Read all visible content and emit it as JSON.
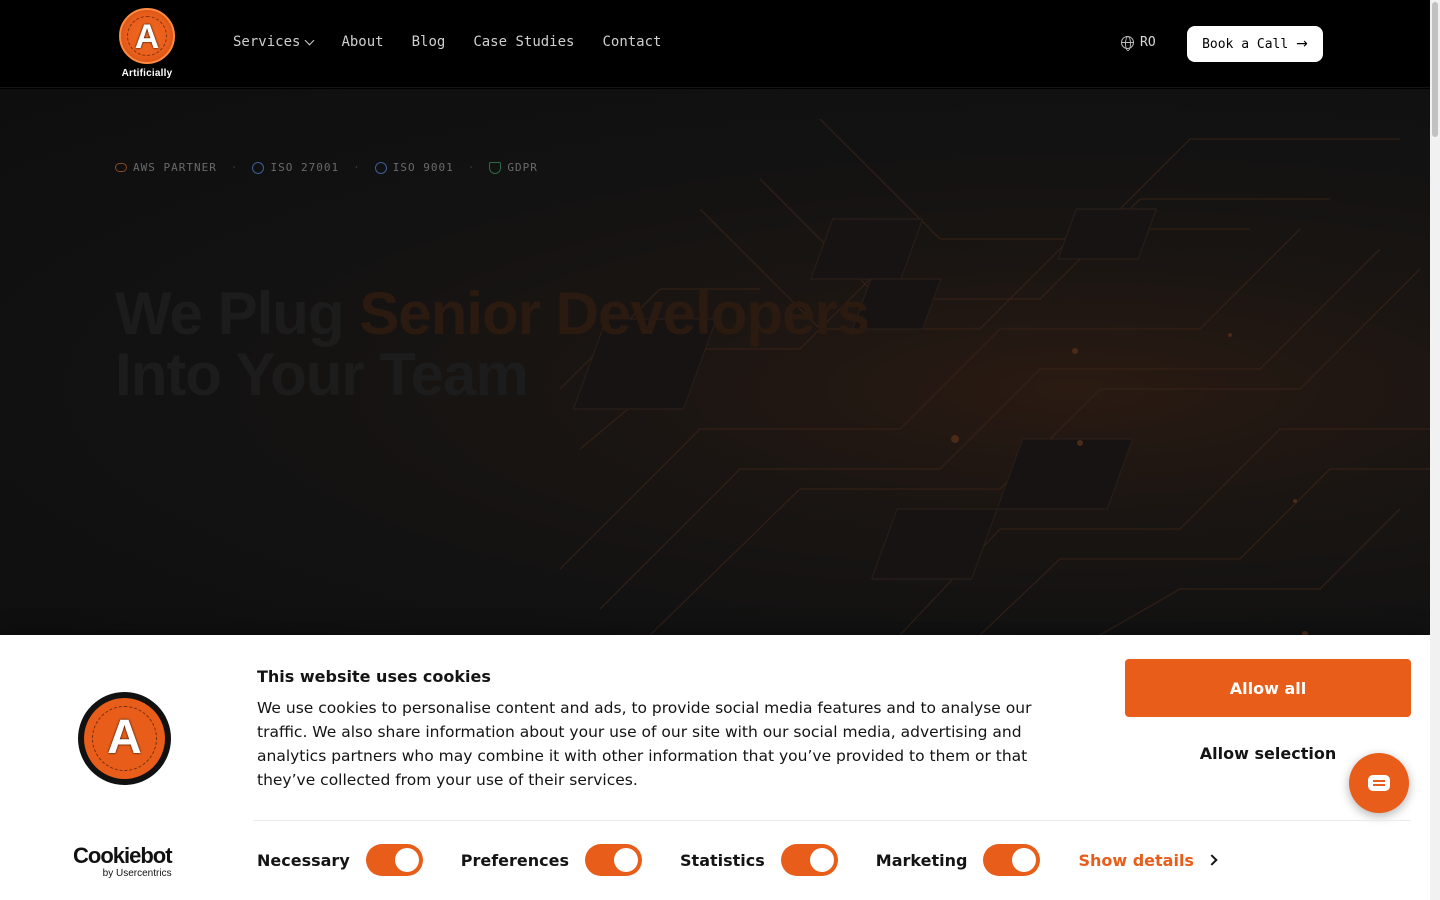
{
  "header": {
    "logo_text": "Artificially",
    "logo_letter": "A",
    "nav": [
      {
        "label": "Services",
        "has_dropdown": true
      },
      {
        "label": "About"
      },
      {
        "label": "Blog"
      },
      {
        "label": "Case Studies"
      },
      {
        "label": "Contact"
      }
    ],
    "language": "RO",
    "cta_label": "Book a Call"
  },
  "hero": {
    "badges": [
      {
        "label": "AWS PARTNER",
        "icon": "cloud-icon"
      },
      {
        "label": "ISO 27001",
        "icon": "globe-icon"
      },
      {
        "label": "ISO 9001",
        "icon": "globe-icon"
      },
      {
        "label": "GDPR",
        "icon": "shield-icon"
      }
    ],
    "headline_part1": "We Plug ",
    "headline_accent": "Senior Developers",
    "headline_part2": "Into Your Team"
  },
  "cookie": {
    "title": "This website uses cookies",
    "text": "We use cookies to personalise content and ads, to provide social media features and to analyse our traffic. We also share information about your use of our site with our social media, advertising and analytics partners who may combine it with other information that you’ve provided to them or that they’ve collected from your use of their services.",
    "allow_all": "Allow all",
    "allow_selection": "Allow selection",
    "toggles": [
      {
        "label": "Necessary",
        "on": true
      },
      {
        "label": "Preferences",
        "on": true
      },
      {
        "label": "Statistics",
        "on": true
      },
      {
        "label": "Marketing",
        "on": true
      }
    ],
    "show_details": "Show details",
    "provider_main": "Cookiebot",
    "provider_sub": "by Usercentrics"
  },
  "colors": {
    "accent": "#e85d1a",
    "background": "#000000"
  }
}
